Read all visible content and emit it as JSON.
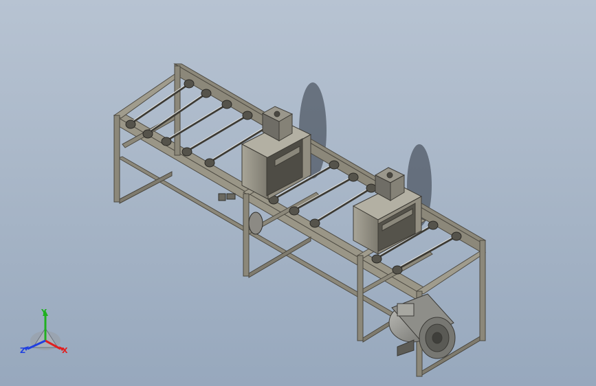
{
  "viewport": {
    "background_top": "#b7c3d2",
    "background_bottom": "#97a8bd",
    "frame_color": "#8c887a",
    "frame_shadow": "#5e5b52",
    "motor_color": "#8a8a86"
  },
  "triad": {
    "x_label": "X",
    "y_label": "Y",
    "z_label": "Z",
    "x_color": "#e02020",
    "y_color": "#20b020",
    "z_color": "#2040e0"
  }
}
